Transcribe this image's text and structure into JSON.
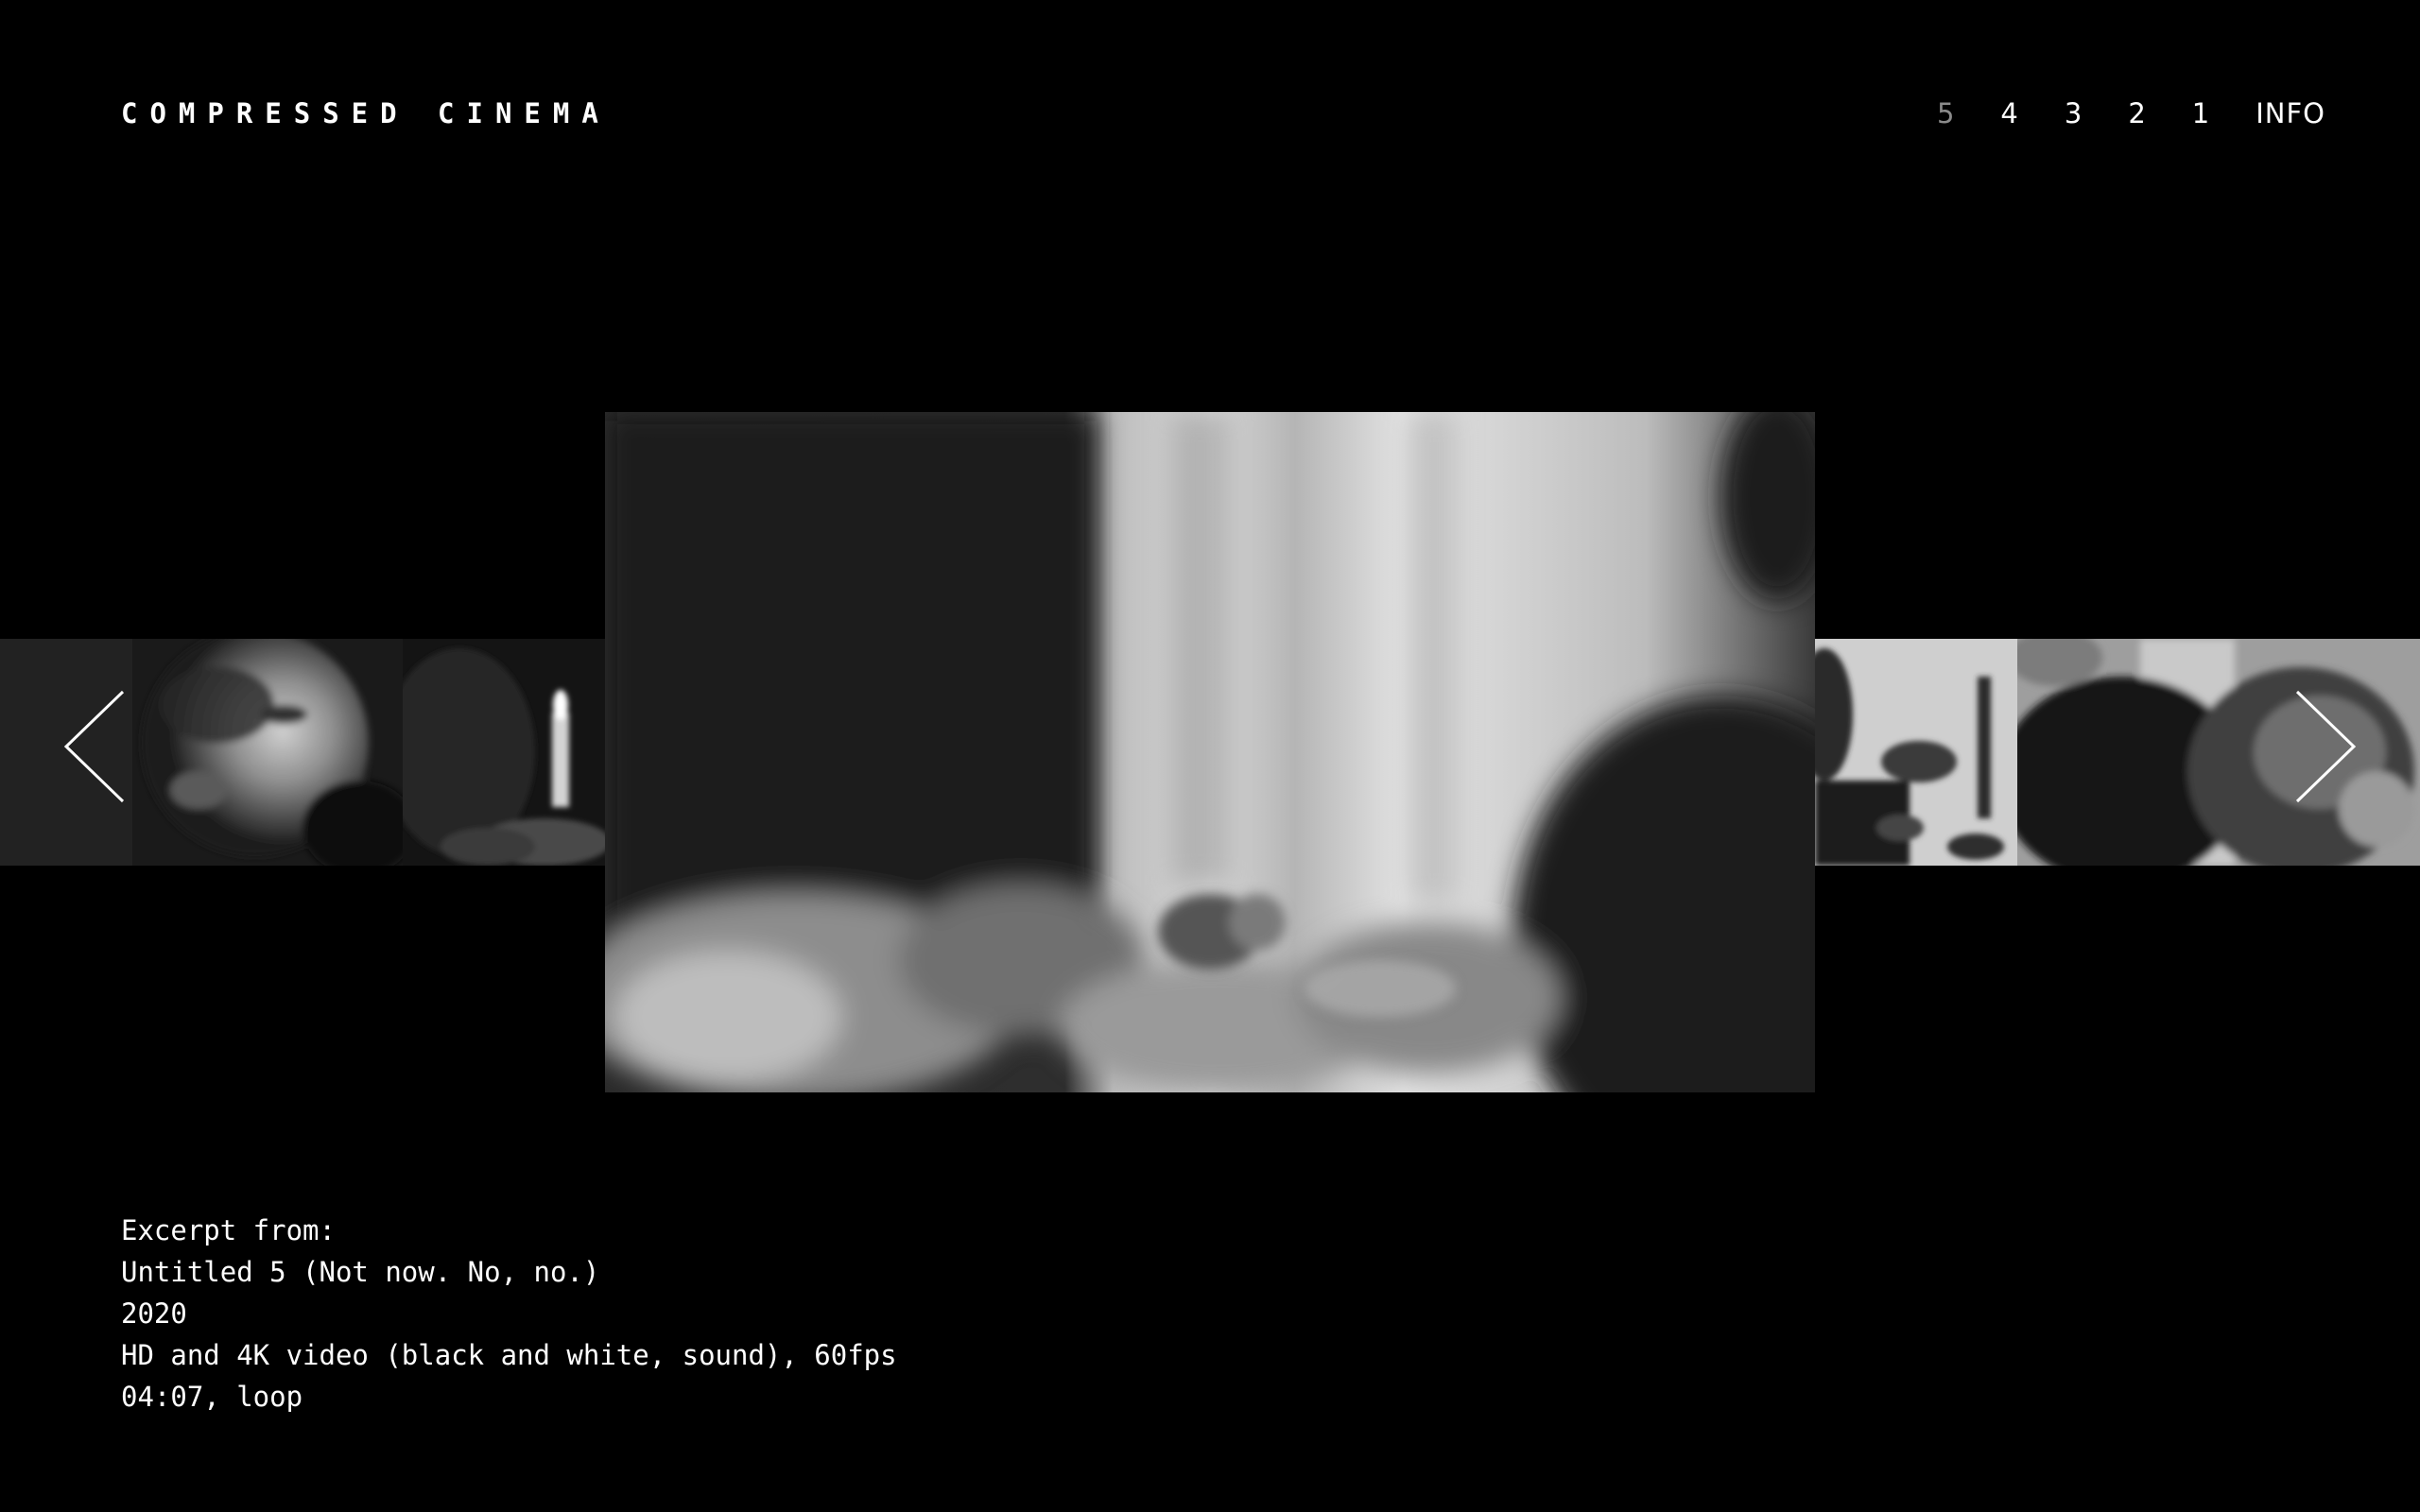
{
  "site": {
    "title": "COMPRESSED CINEMA"
  },
  "nav": {
    "items": [
      {
        "label": "5",
        "active": true
      },
      {
        "label": "4",
        "active": false
      },
      {
        "label": "3",
        "active": false
      },
      {
        "label": "2",
        "active": false
      },
      {
        "label": "1",
        "active": false
      },
      {
        "label": "INFO",
        "active": false
      }
    ]
  },
  "carousel": {
    "prev_icon": "chevron-left-icon",
    "next_icon": "chevron-right-icon",
    "current_frame": "video-still-5"
  },
  "caption": {
    "line1": "Excerpt from:",
    "line2": "Untitled 5 (Not now. No, no.)",
    "line3": "2020",
    "line4": "HD and 4K video (black and white, sound), 60fps",
    "line5": "04:07, loop"
  },
  "colors": {
    "background": "#000000",
    "text": "#ffffff",
    "nav_active": "#8a8a8a"
  }
}
